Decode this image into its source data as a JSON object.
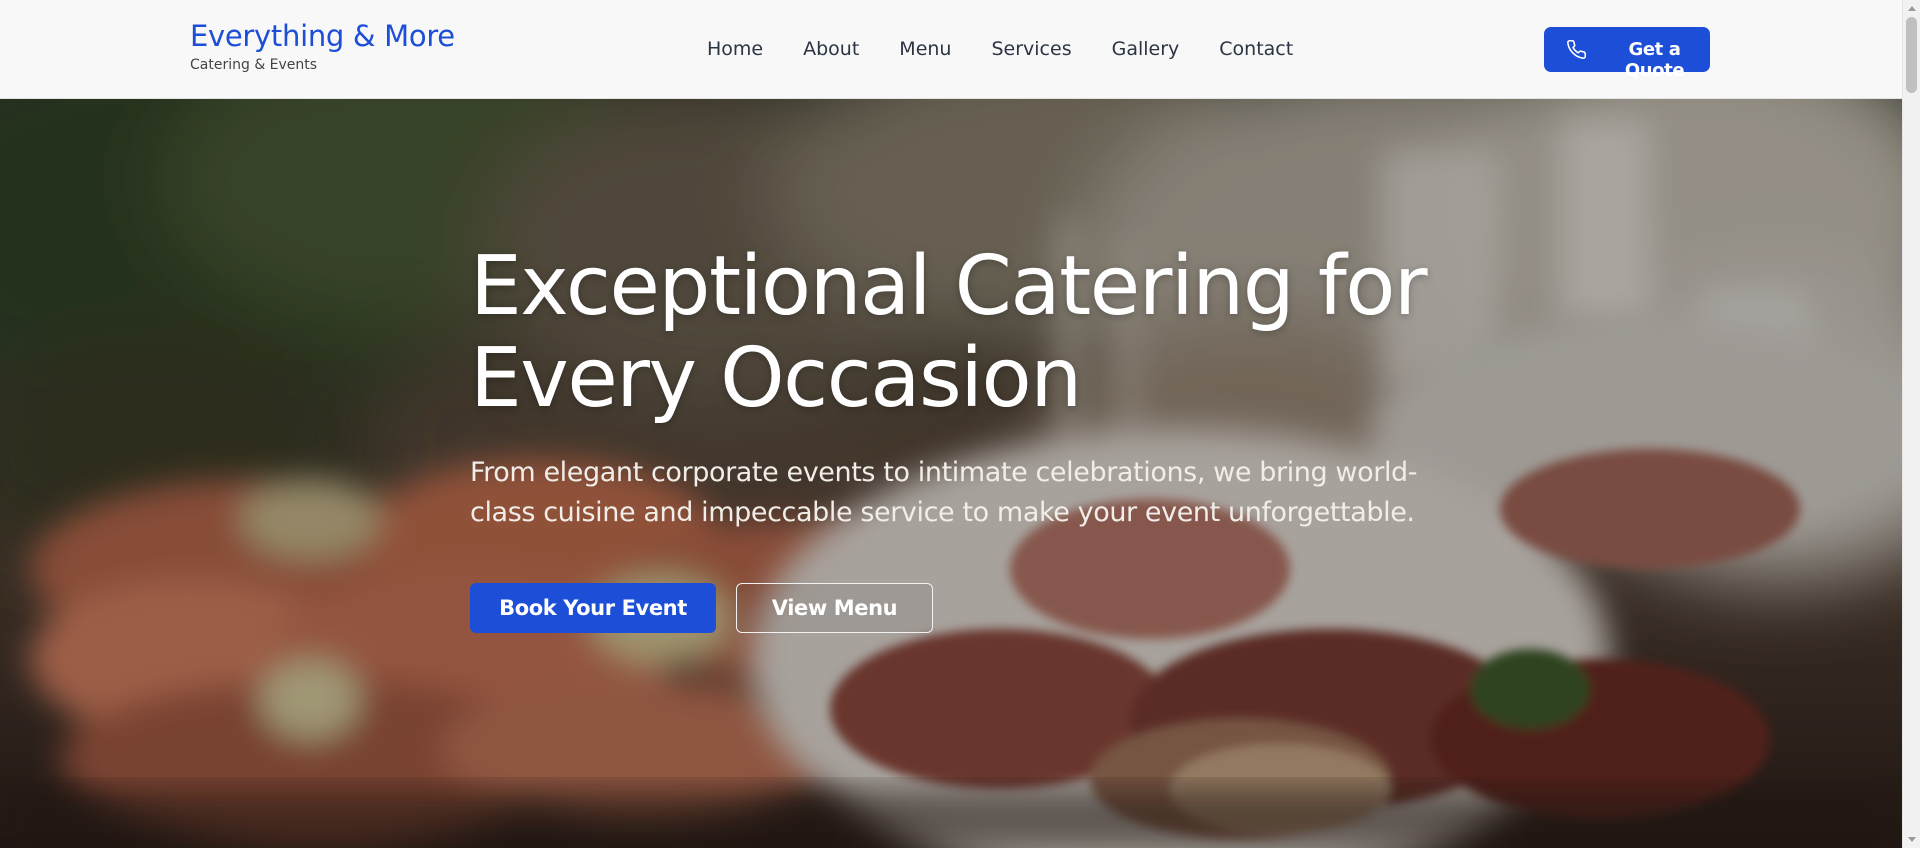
{
  "brand": {
    "title": "Everything & More",
    "subtitle": "Catering & Events"
  },
  "nav": {
    "items": [
      {
        "label": "Home"
      },
      {
        "label": "About"
      },
      {
        "label": "Menu"
      },
      {
        "label": "Services"
      },
      {
        "label": "Gallery"
      },
      {
        "label": "Contact"
      }
    ]
  },
  "header": {
    "cta_label": "Get a Quote",
    "cta_icon": "phone-icon"
  },
  "hero": {
    "headline_line1": "Exceptional Catering for",
    "headline_line2": "Every Occasion",
    "subtext": "From elegant corporate events to intimate celebrations, we bring world-class cuisine and impeccable service to make your event unforgettable.",
    "primary_button": "Book Your Event",
    "secondary_button": "View Menu",
    "background_image": "catering-platters-photo"
  },
  "colors": {
    "accent": "#1d4ed8",
    "header_bg": "#f8f8f8",
    "nav_text": "#2b3443"
  }
}
